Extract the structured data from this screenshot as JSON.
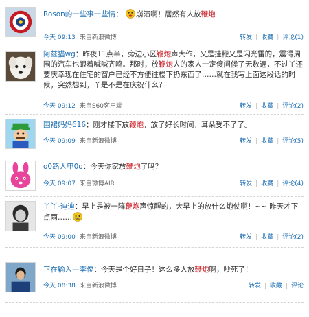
{
  "posts": [
    {
      "user": "Roson的一些事一些情",
      "colon": "：",
      "pre": "",
      "post": "崩溃啊！居然有人放",
      "kw": "鞭炮",
      "tail": "",
      "emoji_icon": "crying-face-icon",
      "time": "今天 09:13",
      "source": "来自新浪微博",
      "repost": "转发",
      "fav": "收藏",
      "comment": "评论(1)",
      "avatar_icon": "round-emblem-avatar"
    },
    {
      "user": "阿兹猫wg",
      "colon": "：",
      "text_html_parts": [
        {
          "t": "昨夜11点半，旁边小区"
        },
        {
          "t": "鞭炮",
          "kw": true
        },
        {
          "t": "声大作，又是挂鞭又是闪光雷的，震得周围的汽车也跟着喊喊齐鸣。那时，放"
        },
        {
          "t": "鞭炮",
          "kw": true
        },
        {
          "t": "人的家人一定傻问候了无数遍，不过丫还要庆幸现在住宅的窗户已经不方便往楼下扔东西了……就在我写上面这段话的时候，突然想到，丫是不是在庆祝什么？"
        }
      ],
      "time": "今天 09:12",
      "source": "来自S60客户端",
      "repost": "转发",
      "fav": "收藏",
      "comment": "评论(2)",
      "avatar_icon": "white-dog-avatar"
    },
    {
      "user": "围裙妈妈616",
      "colon": "：",
      "text_html_parts": [
        {
          "t": "刚才楼下放"
        },
        {
          "t": "鞭炮",
          "kw": true
        },
        {
          "t": "，放了好长时间，耳朵受不了了。"
        }
      ],
      "time": "今天 09:09",
      "source": "来自新浪微博",
      "repost": "转发",
      "fav": "收藏",
      "comment": "评论(5)",
      "avatar_icon": "mario-character-avatar"
    },
    {
      "user": "o0路人甲0o",
      "colon": "：",
      "text_html_parts": [
        {
          "t": "今天你家放"
        },
        {
          "t": "鞭炮",
          "kw": true
        },
        {
          "t": "了吗？"
        }
      ],
      "time": "今天 09:07",
      "source": "来自微博AIR",
      "repost": "转发",
      "fav": "收藏",
      "comment": "评论(4)",
      "avatar_icon": "pink-rabbit-avatar"
    },
    {
      "user": "丫丫-迪迪",
      "colon": "：",
      "text_html_parts": [
        {
          "t": "早上是被一阵"
        },
        {
          "t": "鞭炮",
          "kw": true
        },
        {
          "t": "声惊醒的，大早上的放什么炮仗啊！~~ 昨天才下点雨……"
        }
      ],
      "emoji_icon": "teary-face-icon",
      "time": "今天 09:00",
      "source": "来自新浪微博",
      "repost": "转发",
      "fav": "收藏",
      "comment": "评论(2)",
      "avatar_icon": "bw-portrait-avatar"
    },
    {
      "user": "正在输入—李俊",
      "colon": "：",
      "text_html_parts": [
        {
          "t": "今天是个好日子！这么多人放"
        },
        {
          "t": "鞭炮",
          "kw": true
        },
        {
          "t": "啊，吵死了！"
        }
      ],
      "time": "今天 08:38",
      "source": "来自新浪微博",
      "repost": "转发",
      "fav": "收藏",
      "comment": "评论",
      "avatar_icon": "person-photo-avatar"
    }
  ],
  "colors": {
    "link": "#1f6fb2",
    "keyword": "#c8171f",
    "text": "#333333"
  }
}
